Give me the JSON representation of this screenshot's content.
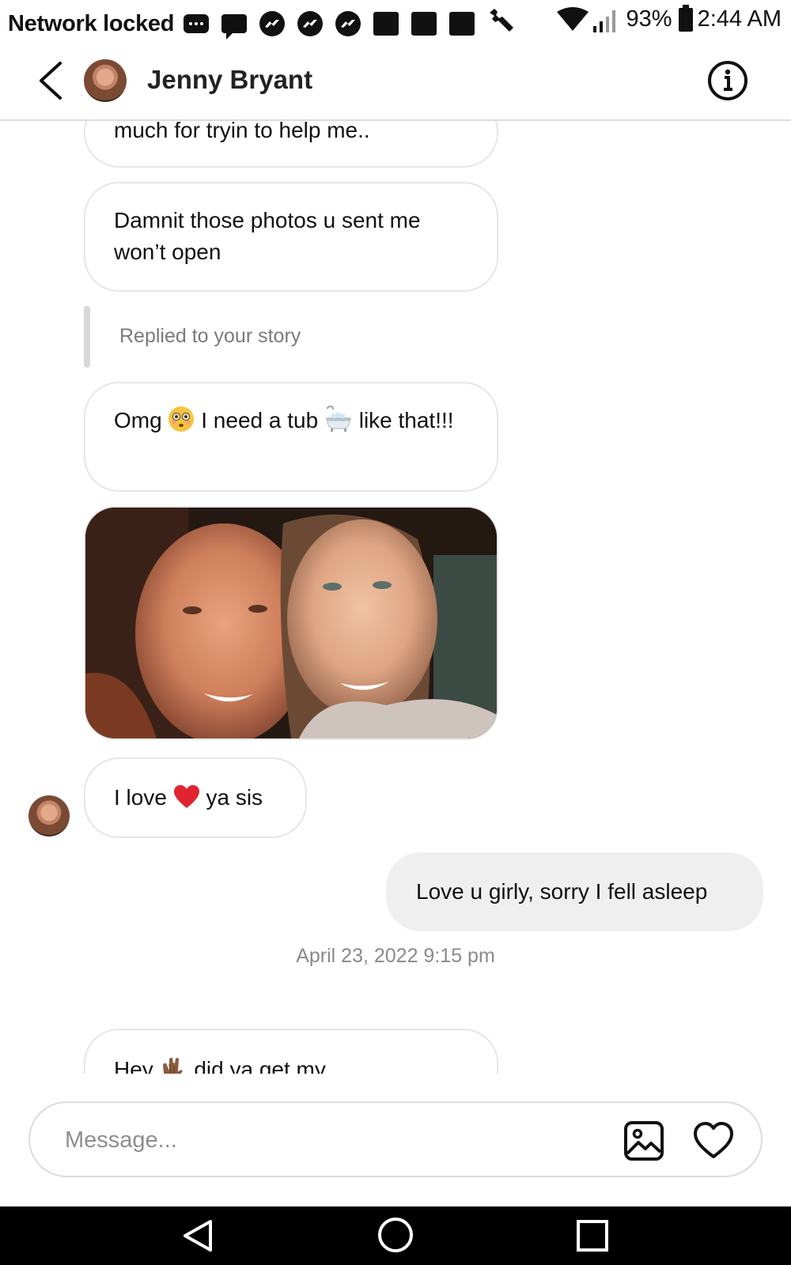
{
  "status_bar": {
    "carrier": "Network locked",
    "battery": "93%",
    "time": "2:44 AM"
  },
  "header": {
    "contact_name": "Jenny Bryant"
  },
  "messages": {
    "partial_top": "much for tryin to help me..",
    "photos_wont_open": "Damnit those photos u sent me won’t open",
    "story_reply_label": "Replied to your story",
    "tub_part1": "Omg ",
    "tub_part2": " I need a tub ",
    "tub_part3": " like that!!!",
    "love_part1": "I love ",
    "love_part2": " ya sis",
    "sent_reply": "Love u girly, sorry I fell asleep",
    "timestamp": "April 23, 2022 9:15 pm",
    "partial_bottom_part1": "Hey ",
    "partial_bottom_part2": " did ya get my"
  },
  "composer": {
    "placeholder": "Message..."
  },
  "colors": {
    "sent_bubble": "#efefef",
    "received_border": "#e6e6e6",
    "heart_emoji": "#e0242f"
  },
  "icons": [
    "back-arrow-icon",
    "info-icon",
    "gallery-icon",
    "heart-icon",
    "flushed-face-emoji",
    "bathtub-emoji",
    "red-heart-emoji",
    "clapping-hands-emoji"
  ]
}
